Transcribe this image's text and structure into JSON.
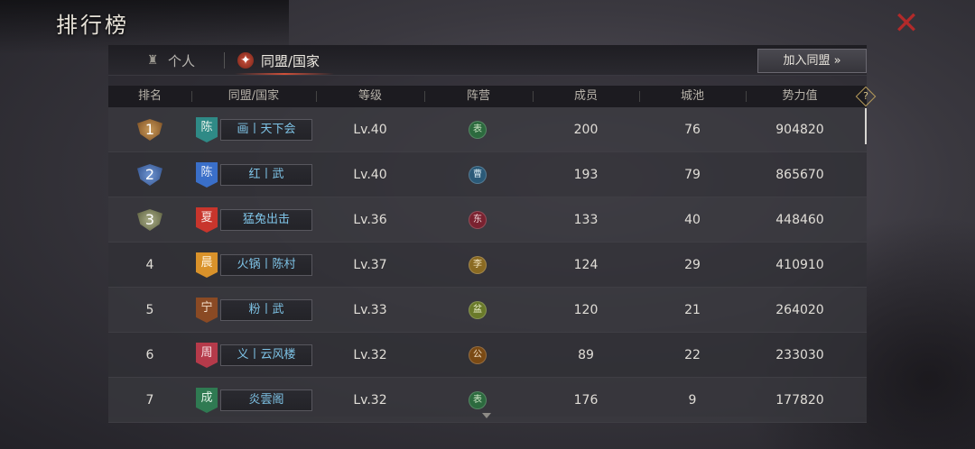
{
  "title": "排行榜",
  "tabs": {
    "person": "个人",
    "alliance": "同盟/国家"
  },
  "join_button": "加入同盟 »",
  "help_label": "?",
  "columns": [
    "排名",
    "同盟/国家",
    "等级",
    "阵营",
    "成员",
    "城池",
    "势力值"
  ],
  "rows": [
    {
      "rank": "1",
      "flag_char": "陈",
      "flag_color": "#2f8a86",
      "name": "画丨天下会",
      "level": "Lv.40",
      "camp_char": "表",
      "camp_color": "#2c6a3e",
      "members": "200",
      "cities": "76",
      "power": "904820"
    },
    {
      "rank": "2",
      "flag_char": "陈",
      "flag_color": "#3a6fc9",
      "name": "红丨武",
      "level": "Lv.40",
      "camp_char": "曹",
      "camp_color": "#2b5a78",
      "members": "193",
      "cities": "79",
      "power": "865670"
    },
    {
      "rank": "3",
      "flag_char": "夏",
      "flag_color": "#c8352c",
      "name": "猛兔出击",
      "level": "Lv.36",
      "camp_char": "东",
      "camp_color": "#7a2230",
      "members": "133",
      "cities": "40",
      "power": "448460"
    },
    {
      "rank": "4",
      "flag_char": "晨",
      "flag_color": "#d9922a",
      "name": "火锅丨陈村",
      "level": "Lv.37",
      "camp_char": "李",
      "camp_color": "#8a6a22",
      "members": "124",
      "cities": "29",
      "power": "410910"
    },
    {
      "rank": "5",
      "flag_char": "宁",
      "flag_color": "#8a4a24",
      "name": "粉丨武",
      "level": "Lv.33",
      "camp_char": "盆",
      "camp_color": "#6a7a2a",
      "members": "120",
      "cities": "21",
      "power": "264020"
    },
    {
      "rank": "6",
      "flag_char": "周",
      "flag_color": "#b53a4a",
      "name": "义丨云风楼",
      "level": "Lv.32",
      "camp_char": "公",
      "camp_color": "#7a4a14",
      "members": "89",
      "cities": "22",
      "power": "233030"
    },
    {
      "rank": "7",
      "flag_char": "成",
      "flag_color": "#2f7a52",
      "name": "炎雲阁",
      "level": "Lv.32",
      "camp_char": "表",
      "camp_color": "#2c6a3e",
      "members": "176",
      "cities": "9",
      "power": "177820"
    }
  ],
  "colors": {
    "accent_red": "#b22a2a",
    "rank1": "#b47a3c",
    "rank2": "#4f78b5",
    "rank3": "#8a8f6a",
    "name_text": "#7ec3e6"
  }
}
